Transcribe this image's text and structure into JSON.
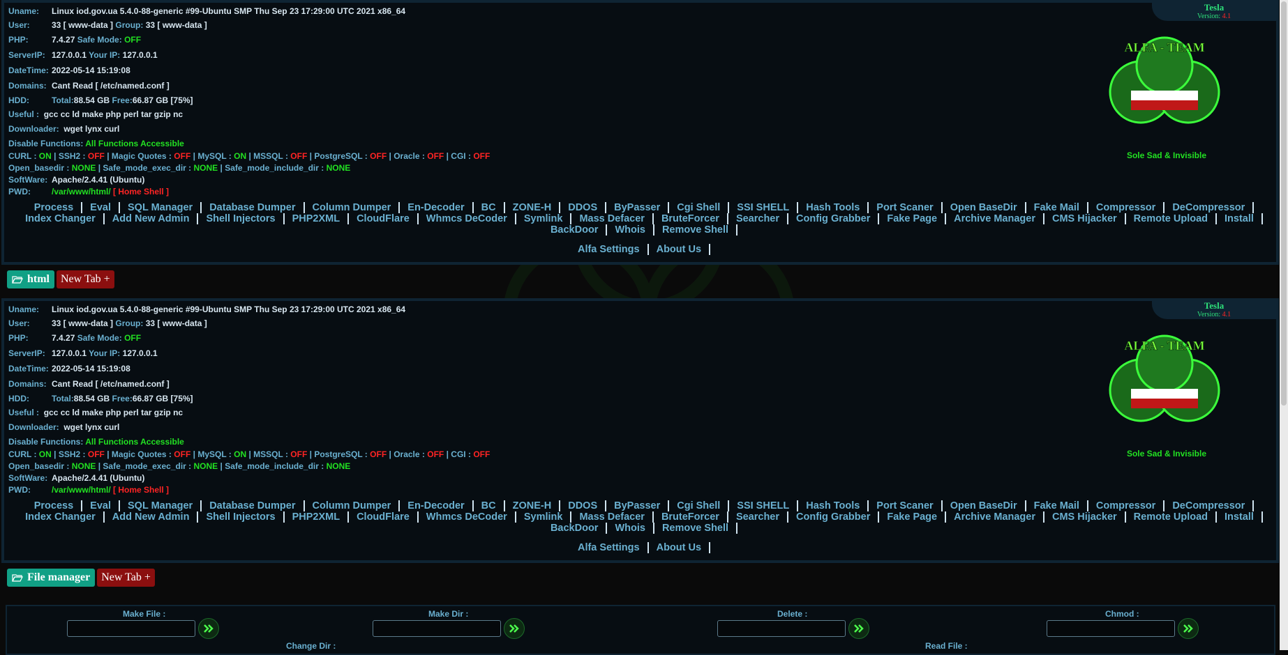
{
  "info": {
    "uname_label": "Uname:",
    "uname": "Linux iod.gov.ua 5.4.0-88-generic #99-Ubuntu SMP Thu Sep 23 17:29:00 UTC 2021 x86_64",
    "user_label": "User:",
    "user_id": "33 [ www-data ]",
    "group_label": "Group:",
    "group": "33 [ www-data ]",
    "php_label": "PHP:",
    "php": "7.4.27",
    "safe_mode_label": "Safe Mode:",
    "safe_mode": "OFF",
    "serverip_label": "ServerIP:",
    "serverip": "127.0.0.1",
    "yourip_label": "Your IP:",
    "yourip": "127.0.0.1",
    "datetime_label": "DateTime:",
    "datetime": "2022-05-14 15:19:08",
    "domains_label": "Domains:",
    "domains": "Cant Read [ /etc/named.conf ]",
    "hdd_label": "HDD:",
    "total_label": "Total:",
    "total": "88.54 GB",
    "free_label": "Free:",
    "free": "66.87 GB [75%]",
    "useful_label": "Useful :",
    "useful": "gcc cc ld make php perl tar gzip nc",
    "downloader_label": "Downloader:",
    "downloader": "wget lynx curl",
    "disable_label": "Disable Functions:",
    "disable": "All Functions Accessible",
    "curl_label": "CURL :",
    "curl": "ON",
    "ssh2_label": "SSH2 :",
    "ssh2": "OFF",
    "magic_label": "Magic Quotes :",
    "magic": "OFF",
    "mysql_label": "MySQL :",
    "mysql": "ON",
    "mssql_label": "MSSQL :",
    "mssql": "OFF",
    "pgsql_label": "PostgreSQL :",
    "pgsql": "OFF",
    "oracle_label": "Oracle :",
    "oracle": "OFF",
    "cgi_label": "CGI :",
    "cgi": "OFF",
    "openbase_label": "Open_basedir :",
    "openbase": "NONE",
    "safeexec_label": "Safe_mode_exec_dir :",
    "safeexec": "NONE",
    "safeinc_label": "Safe_mode_include_dir :",
    "safeinc": "NONE",
    "software_label": "SoftWare:",
    "software": "Apache/2.4.41 (Ubuntu)",
    "pwd_label": "PWD:",
    "pwd": "/var/www/html/",
    "home_shell": "[ Home Shell ]",
    "sep": "|"
  },
  "brand": {
    "name": "Tesla",
    "version_label": "Version:",
    "version": "4.1",
    "slogan": "Sole Sad & Invisible",
    "logo_text": "ALFA - TEAM"
  },
  "menu": {
    "line1": [
      "Process",
      "Eval",
      "SQL Manager",
      "Database Dumper",
      "Column Dumper",
      "En-Decoder",
      "BC",
      "ZONE-H",
      "DDOS",
      "ByPasser",
      "Cgi Shell",
      "SSI SHELL",
      "Hash Tools",
      "Port Scaner",
      "Open BaseDir",
      "Fake Mail",
      "Compressor",
      "DeCompressor"
    ],
    "line2": [
      "Index Changer",
      "Add New Admin",
      "Shell Injectors",
      "PHP2XML",
      "CloudFlare",
      "Whmcs DeCoder",
      "Symlink",
      "Mass Defacer",
      "BruteForcer",
      "Searcher",
      "Config Grabber",
      "Fake Page",
      "Archive Manager",
      "CMS Hijacker",
      "Remote Upload",
      "Install"
    ],
    "line3": [
      "BackDoor",
      "Whois",
      "Remove Shell"
    ],
    "extra": [
      "Alfa Settings",
      "About Us"
    ]
  },
  "tabs1": {
    "active": "html",
    "new": "New Tab +"
  },
  "tabs2": {
    "active": "File manager",
    "new": "New Tab +"
  },
  "file_manager": {
    "make_file": "Make File :",
    "make_dir": "Make Dir :",
    "delete": "Delete :",
    "chmod": "Chmod :",
    "change_dir": "Change Dir :",
    "read_file": "Read File :"
  },
  "colors": {
    "on": "#22e022",
    "off": "#ff2424",
    "accent": "#6ab0d0",
    "tab": "#11a085",
    "newtab": "#8b0f0f"
  }
}
